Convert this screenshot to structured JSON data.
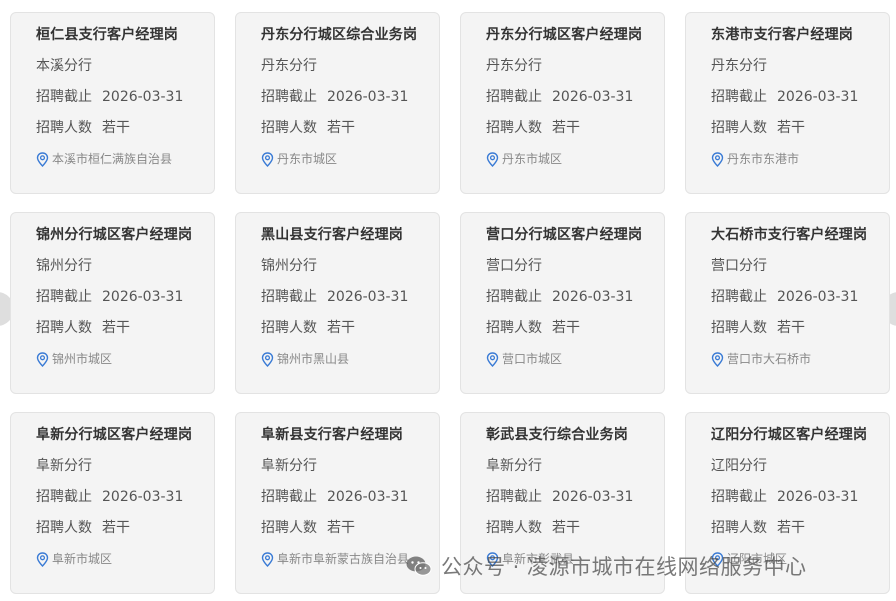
{
  "labels": {
    "deadline": "招聘截止",
    "headcount": "招聘人数"
  },
  "cards": [
    {
      "title": "桓仁县支行客户经理岗",
      "branch": "本溪分行",
      "deadline": "2026-03-31",
      "headcount": "若干",
      "location": "本溪市桓仁满族自治县"
    },
    {
      "title": "丹东分行城区综合业务岗",
      "branch": "丹东分行",
      "deadline": "2026-03-31",
      "headcount": "若干",
      "location": "丹东市城区"
    },
    {
      "title": "丹东分行城区客户经理岗",
      "branch": "丹东分行",
      "deadline": "2026-03-31",
      "headcount": "若干",
      "location": "丹东市城区"
    },
    {
      "title": "东港市支行客户经理岗",
      "branch": "丹东分行",
      "deadline": "2026-03-31",
      "headcount": "若干",
      "location": "丹东市东港市"
    },
    {
      "title": "锦州分行城区客户经理岗",
      "branch": "锦州分行",
      "deadline": "2026-03-31",
      "headcount": "若干",
      "location": "锦州市城区"
    },
    {
      "title": "黑山县支行客户经理岗",
      "branch": "锦州分行",
      "deadline": "2026-03-31",
      "headcount": "若干",
      "location": "锦州市黑山县"
    },
    {
      "title": "营口分行城区客户经理岗",
      "branch": "营口分行",
      "deadline": "2026-03-31",
      "headcount": "若干",
      "location": "营口市城区"
    },
    {
      "title": "大石桥市支行客户经理岗",
      "branch": "营口分行",
      "deadline": "2026-03-31",
      "headcount": "若干",
      "location": "营口市大石桥市"
    },
    {
      "title": "阜新分行城区客户经理岗",
      "branch": "阜新分行",
      "deadline": "2026-03-31",
      "headcount": "若干",
      "location": "阜新市城区"
    },
    {
      "title": "阜新县支行客户经理岗",
      "branch": "阜新分行",
      "deadline": "2026-03-31",
      "headcount": "若干",
      "location": "阜新市阜新蒙古族自治县"
    },
    {
      "title": "彰武县支行综合业务岗",
      "branch": "阜新分行",
      "deadline": "2026-03-31",
      "headcount": "若干",
      "location": "阜新市彰武县"
    },
    {
      "title": "辽阳分行城区客户经理岗",
      "branch": "辽阳分行",
      "deadline": "2026-03-31",
      "headcount": "若干",
      "location": "辽阳市城区"
    }
  ],
  "watermark": {
    "text": "公众号 · 凌源市城市在线网络服务中心",
    "icon": "wechat-icon"
  },
  "colors": {
    "card_bg": "#f4f4f4",
    "pin": "#3a7bd5",
    "title": "#333333"
  }
}
